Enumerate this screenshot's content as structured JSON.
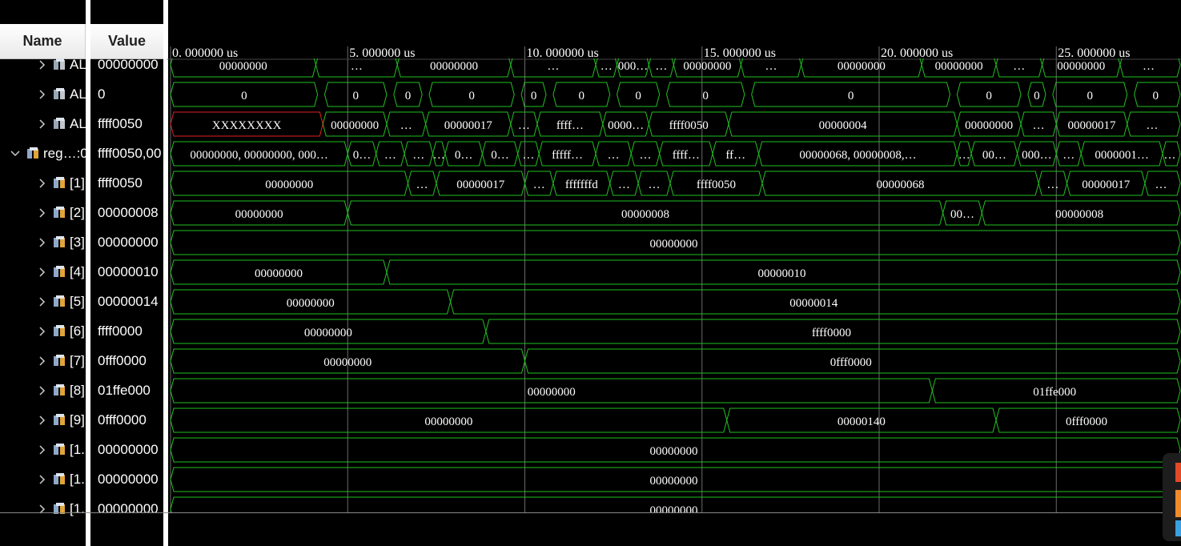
{
  "columns": {
    "name": "Name",
    "value": "Value"
  },
  "time_labels": [
    "0. 000000  us",
    "5. 000000  us",
    "10. 000000  us",
    "15. 000000  us",
    "20. 000000  us",
    "25. 000000  us"
  ],
  "rows": [
    {
      "name": "AL",
      "value": "00000000",
      "expand": "right",
      "icon": "sig-icon-gray",
      "wave": [
        [
          "00000000",
          0,
          4.1
        ],
        [
          "…",
          4.1,
          6.4
        ],
        [
          "00000000",
          6.4,
          9.6
        ],
        [
          "…",
          9.6,
          12.0
        ],
        [
          "…",
          12.0,
          12.6
        ],
        [
          "000…",
          12.6,
          13.5
        ],
        [
          "…",
          13.5,
          14.2
        ],
        [
          "00000000",
          14.2,
          16.1
        ],
        [
          "…",
          16.1,
          17.8
        ],
        [
          "00000000",
          17.8,
          21.2
        ],
        [
          "00000000",
          21.2,
          23.3
        ],
        [
          "…",
          23.3,
          24.6
        ],
        [
          "00000000",
          24.6,
          26.8
        ],
        [
          "…",
          26.8,
          28.5
        ]
      ]
    },
    {
      "name": "AL",
      "value": "0",
      "expand": "right",
      "icon": "sig-icon-gray",
      "wave": [
        [
          "0",
          0,
          4.15
        ],
        [
          "0",
          4.35,
          6.1
        ],
        [
          "0",
          6.3,
          7.1
        ],
        [
          "0",
          7.3,
          9.7
        ],
        [
          "0",
          9.9,
          10.6
        ],
        [
          "0",
          10.8,
          12.4
        ],
        [
          "0",
          12.6,
          13.8
        ],
        [
          "0",
          14.0,
          16.2
        ],
        [
          "0",
          16.4,
          22.0
        ],
        [
          "0",
          22.2,
          24.0
        ],
        [
          "0",
          24.2,
          24.7
        ],
        [
          "0",
          24.9,
          27.0
        ],
        [
          "0",
          27.2,
          28.5
        ]
      ]
    },
    {
      "name": "AL",
      "value": "ffff0050",
      "expand": "right",
      "icon": "sig-icon-gray",
      "unknown": [
        0,
        4.3
      ],
      "wave": [
        [
          "XXXXXXXX",
          0,
          4.3
        ],
        [
          "00000000",
          4.3,
          6.1
        ],
        [
          "…",
          6.1,
          7.2
        ],
        [
          "00000017",
          7.2,
          9.6
        ],
        [
          "…",
          9.6,
          10.35
        ],
        [
          "ffff…",
          10.35,
          12.2
        ],
        [
          "0000…",
          12.2,
          13.5
        ],
        [
          "ffff0050",
          13.5,
          15.75
        ],
        [
          "00000004",
          15.75,
          22.2
        ],
        [
          "00000000",
          22.2,
          24.0
        ],
        [
          "…",
          24.0,
          25.0
        ],
        [
          "00000017",
          25.0,
          27.0
        ],
        [
          "…",
          27.0,
          28.5
        ]
      ]
    },
    {
      "name": "reg…:0",
      "value": "ffff0050,00",
      "expand": "down",
      "icon": "sig-icon-array",
      "wave": [
        [
          "00000000, 00000000, 000…",
          0,
          5.0
        ],
        [
          "0…",
          5.0,
          5.8
        ],
        [
          "…",
          5.8,
          6.6
        ],
        [
          "…",
          6.6,
          7.4
        ],
        [
          "…",
          7.4,
          7.75
        ],
        [
          "0…",
          7.75,
          8.8
        ],
        [
          "0…",
          8.8,
          9.8
        ],
        [
          "…",
          9.8,
          10.4
        ],
        [
          "fffff…",
          10.4,
          12.0
        ],
        [
          "…",
          12.0,
          13.0
        ],
        [
          "…",
          13.0,
          13.8
        ],
        [
          "ffff…",
          13.8,
          15.3
        ],
        [
          "ff…",
          15.3,
          16.6
        ],
        [
          "00000068, 00000008,…",
          16.6,
          22.2
        ],
        [
          "…",
          22.2,
          22.6
        ],
        [
          "00…",
          22.6,
          23.9
        ],
        [
          "000…",
          23.9,
          25.0
        ],
        [
          "…",
          25.0,
          25.7
        ],
        [
          "0000001…",
          25.7,
          28.0
        ],
        [
          "…",
          28.0,
          28.5
        ]
      ]
    },
    {
      "name": "[1]",
      "value": "ffff0050",
      "expand": "right",
      "icon": "sig-icon-bus",
      "wave": [
        [
          "00000000",
          0,
          6.7
        ],
        [
          "…",
          6.7,
          7.5
        ],
        [
          "00000017",
          7.5,
          10.0
        ],
        [
          "…",
          10.0,
          10.8
        ],
        [
          "fffffffd",
          10.8,
          12.4
        ],
        [
          "…",
          12.4,
          13.2
        ],
        [
          "…",
          13.2,
          14.1
        ],
        [
          "ffff0050",
          14.1,
          16.7
        ],
        [
          "00000068",
          16.7,
          24.5
        ],
        [
          "…",
          24.5,
          25.3
        ],
        [
          "00000017",
          25.3,
          27.5
        ],
        [
          "…",
          27.5,
          28.5
        ]
      ]
    },
    {
      "name": "[2]",
      "value": "00000008",
      "expand": "right",
      "icon": "sig-icon-bus",
      "wave": [
        [
          "00000000",
          0,
          5.0
        ],
        [
          "00000008",
          5.0,
          21.8
        ],
        [
          "00…",
          21.8,
          22.9
        ],
        [
          "00000008",
          22.9,
          28.5
        ]
      ]
    },
    {
      "name": "[3]",
      "value": "00000000",
      "expand": "right",
      "icon": "sig-icon-bus",
      "wave": [
        [
          "00000000",
          0,
          28.5
        ]
      ]
    },
    {
      "name": "[4]",
      "value": "00000010",
      "expand": "right",
      "icon": "sig-icon-bus",
      "wave": [
        [
          "00000000",
          0,
          6.1
        ],
        [
          "00000010",
          6.1,
          28.5
        ]
      ]
    },
    {
      "name": "[5]",
      "value": "00000014",
      "expand": "right",
      "icon": "sig-icon-bus",
      "wave": [
        [
          "00000000",
          0,
          7.9
        ],
        [
          "00000014",
          7.9,
          28.5
        ]
      ]
    },
    {
      "name": "[6]",
      "value": "ffff0000",
      "expand": "right",
      "icon": "sig-icon-bus",
      "wave": [
        [
          "00000000",
          0,
          8.9
        ],
        [
          "ffff0000",
          8.9,
          28.5
        ]
      ]
    },
    {
      "name": "[7]",
      "value": "0fff0000",
      "expand": "right",
      "icon": "sig-icon-bus",
      "wave": [
        [
          "00000000",
          0,
          10.0
        ],
        [
          "0fff0000",
          10.0,
          28.5
        ]
      ]
    },
    {
      "name": "[8]",
      "value": "01ffe000",
      "expand": "right",
      "icon": "sig-icon-bus",
      "wave": [
        [
          "00000000",
          0,
          21.5
        ],
        [
          "01ffe000",
          21.5,
          28.5
        ]
      ]
    },
    {
      "name": "[9]",
      "value": "0fff0000",
      "expand": "right",
      "icon": "sig-icon-bus",
      "wave": [
        [
          "00000000",
          0,
          15.7
        ],
        [
          "00000140",
          15.7,
          23.3
        ],
        [
          "0fff0000",
          23.3,
          28.5
        ]
      ]
    },
    {
      "name": "[1.",
      "value": "00000000",
      "expand": "right",
      "icon": "sig-icon-bus",
      "wave": [
        [
          "00000000",
          0,
          28.5
        ]
      ]
    },
    {
      "name": "[1.",
      "value": "00000000",
      "expand": "right",
      "icon": "sig-icon-bus",
      "wave": [
        [
          "00000000",
          0,
          28.5
        ]
      ]
    },
    {
      "name": "[1.",
      "value": "00000000",
      "expand": "right",
      "icon": "sig-icon-bus",
      "wave": [
        [
          "00000000",
          0,
          28.5
        ]
      ]
    }
  ],
  "colors": {
    "background": "#000000",
    "wave": "#21c021",
    "unknown": "#e02020",
    "grid": "#6a6a6a",
    "text": "#ffffff",
    "header_text": "#222222"
  }
}
